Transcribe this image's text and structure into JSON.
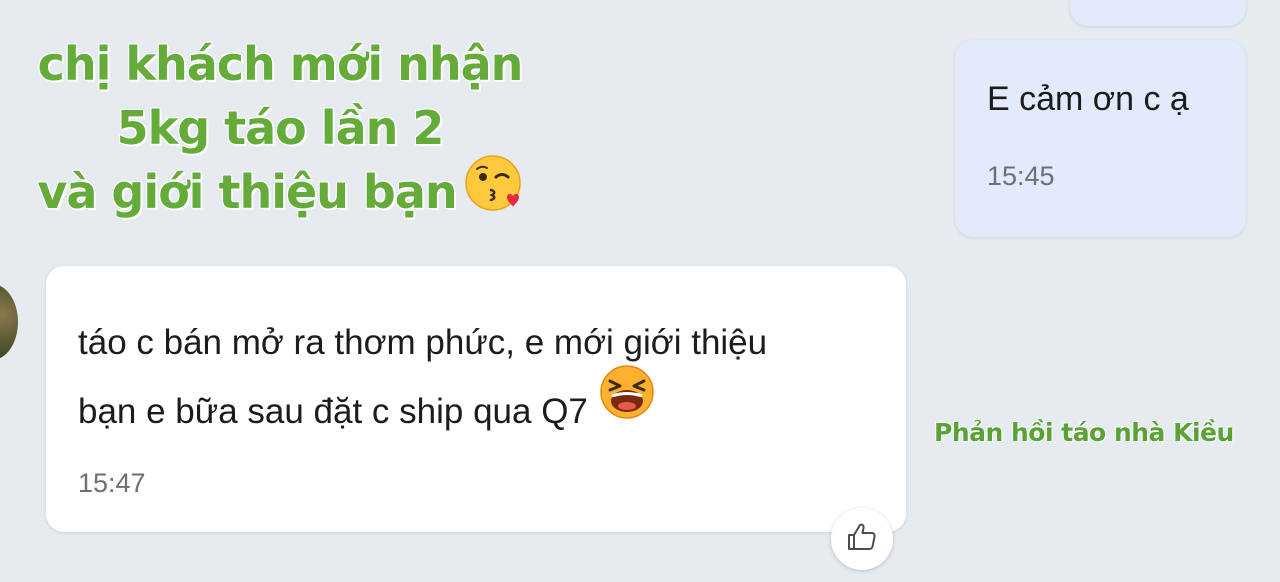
{
  "caption": {
    "lines": [
      "chị khách mới nhận",
      "5kg táo lần 2",
      "và giới thiệu bạn"
    ],
    "emoji": "face-blowing-a-kiss",
    "color": "#64ab3a"
  },
  "messages": [
    {
      "direction": "outgoing",
      "text": "E cảm ơn c ạ",
      "time": "15:45",
      "bubble_color": "#e2eafb"
    },
    {
      "direction": "incoming",
      "lines": [
        "táo c bán mở ra thơm phức, e mới giới thiệu",
        "bạn e bữa sau đặt c ship qua Q7"
      ],
      "emoji": "laughing-face",
      "time": "15:47",
      "bubble_color": "#ffffff"
    }
  ],
  "reaction_button": {
    "icon": "thumbs-up-icon"
  },
  "watermark": {
    "text": "Phản hồi táo nhà Kiều",
    "color": "#5aa235"
  },
  "colors": {
    "background": "#e6ebf0"
  }
}
